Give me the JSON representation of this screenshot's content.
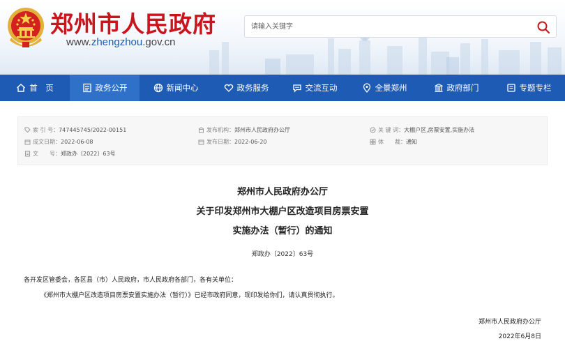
{
  "header": {
    "site_title": "郑州市人民政府",
    "url_prefix": "www.",
    "url_highlight": "zhengzhou",
    "url_suffix": ".gov.cn",
    "search": {
      "placeholder": "请输入关键字",
      "icon": "search-icon"
    }
  },
  "nav": {
    "items": [
      {
        "label": "首　页",
        "icon": "home-icon"
      },
      {
        "label": "政务公开",
        "icon": "document-icon",
        "active": true
      },
      {
        "label": "新闻中心",
        "icon": "globe-icon"
      },
      {
        "label": "政务服务",
        "icon": "heart-icon"
      },
      {
        "label": "交流互动",
        "icon": "chat-icon"
      },
      {
        "label": "全景郑州",
        "icon": "location-icon"
      },
      {
        "label": "政府部门",
        "icon": "building-icon"
      },
      {
        "label": "专题专栏",
        "icon": "book-icon"
      }
    ]
  },
  "meta": {
    "index_label": "索 引 号：",
    "index_value": "747445745/2022-00151",
    "publisher_label": "发布机构：",
    "publisher_value": "郑州市人民政府办公厅",
    "keywords_label": "关 键 词：",
    "keywords_value": "大棚户区,房票安置,实施办法",
    "created_label": "成文日期：",
    "created_value": "2022-06-08",
    "published_label": "发布日期：",
    "published_value": "2022-06-20",
    "genre_label": "体　　裁：",
    "genre_value": "通知",
    "docno_label": "文　　号：",
    "docno_value": "郑政办〔2022〕63号"
  },
  "article": {
    "title_line1": "郑州市人民政府办公厅",
    "title_line2": "关于印发郑州市大棚户区改造项目房票安置",
    "title_line3": "实施办法（暂行）的通知",
    "doc_number": "郑政办〔2022〕63号",
    "salutation": "各开发区管委会，各区县（市）人民政府，市人民政府各部门，各有关单位：",
    "body": "《郑州市大棚户区改造项目房票安置实施办法（暂行）》已经市政府同意，现印发给你们，请认真贯彻执行。",
    "signature": "郑州市人民政府办公厅",
    "date": "2022年6月8日"
  },
  "colors": {
    "nav_bg": "#1d5bb5",
    "nav_active": "#2f71c9",
    "title_red": "#c8161d",
    "url_blue": "#1d5bb5",
    "meta_icon": "#9a9a9a"
  }
}
